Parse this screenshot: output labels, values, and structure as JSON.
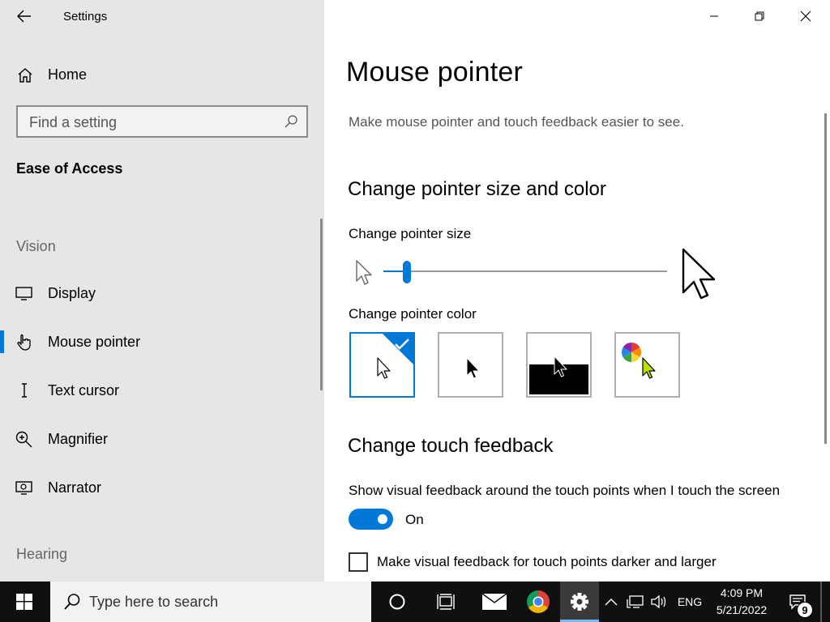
{
  "window": {
    "title": "Settings"
  },
  "sidebar": {
    "home_label": "Home",
    "search_placeholder": "Find a setting",
    "section_title": "Ease of Access",
    "groups": {
      "vision": "Vision",
      "hearing": "Hearing"
    },
    "items": [
      {
        "label": "Display",
        "icon": "monitor-icon"
      },
      {
        "label": "Mouse pointer",
        "icon": "mouse-pointer-icon",
        "selected": true
      },
      {
        "label": "Text cursor",
        "icon": "text-cursor-icon"
      },
      {
        "label": "Magnifier",
        "icon": "magnifier-icon"
      },
      {
        "label": "Narrator",
        "icon": "narrator-icon"
      }
    ]
  },
  "main": {
    "title": "Mouse pointer",
    "description": "Make mouse pointer and touch feedback easier to see.",
    "pointer_section": {
      "heading": "Change pointer size and color",
      "size_label": "Change pointer size",
      "size_value": 1,
      "size_min": 1,
      "size_max": 15,
      "color_label": "Change pointer color",
      "color_options": [
        "white",
        "black",
        "inverted",
        "custom"
      ],
      "selected_color": "white"
    },
    "touch_section": {
      "heading": "Change touch feedback",
      "toggle_label": "Show visual feedback around the touch points when I touch the screen",
      "toggle_state": "On",
      "checkbox_label": "Make visual feedback for touch points darker and larger",
      "checkbox_checked": false
    }
  },
  "taskbar": {
    "search_placeholder": "Type here to search",
    "language": "ENG",
    "time": "4:09 PM",
    "date": "5/21/2022",
    "notification_count": "9"
  },
  "colors": {
    "accent": "#0078d7",
    "sidebar_bg": "#e6e6e6",
    "taskbar_bg": "#101010"
  }
}
